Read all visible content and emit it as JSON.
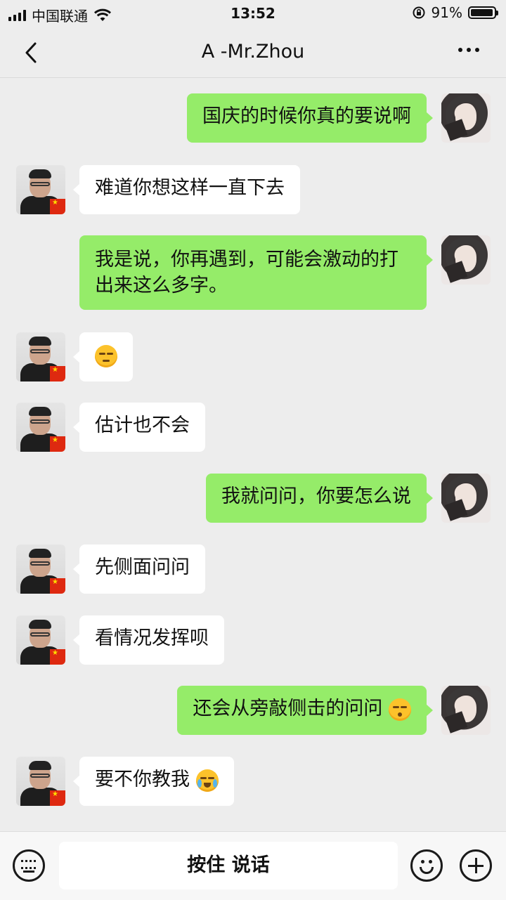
{
  "status_bar": {
    "carrier": "中国联通",
    "time": "13:52",
    "battery": "91%",
    "battery_level": 0.91
  },
  "header": {
    "title": "A -Mr.Zhou",
    "back_icon": "chevron-left-icon",
    "more_icon": "more-dots-icon"
  },
  "messages": [
    {
      "side": "me",
      "text": "国庆的时候你真的要说啊"
    },
    {
      "side": "other",
      "text": "难道你想这样一直下去"
    },
    {
      "side": "me",
      "text": "我是说，你再遇到，可能会激动的打出来这么多字。"
    },
    {
      "side": "other",
      "text": "",
      "emoji": "unamused-face-emoji"
    },
    {
      "side": "other",
      "text": "估计也不会"
    },
    {
      "side": "me",
      "text": "我就问问，你要怎么说"
    },
    {
      "side": "other",
      "text": "先侧面问问"
    },
    {
      "side": "other",
      "text": "看情况发挥呗"
    },
    {
      "side": "me",
      "text": "还会从旁敲侧击的问问",
      "emoji": "kissing-face-emoji"
    },
    {
      "side": "other",
      "text": "要不你教我",
      "emoji": "loudly-crying-face-emoji"
    }
  ],
  "input_bar": {
    "hold_to_talk": "按住 说话",
    "keyboard_icon": "keyboard-icon",
    "emoji_icon": "smiley-icon",
    "plus_icon": "plus-icon"
  },
  "colors": {
    "background": "#ededed",
    "my_bubble": "#95ec69",
    "other_bubble": "#ffffff"
  }
}
